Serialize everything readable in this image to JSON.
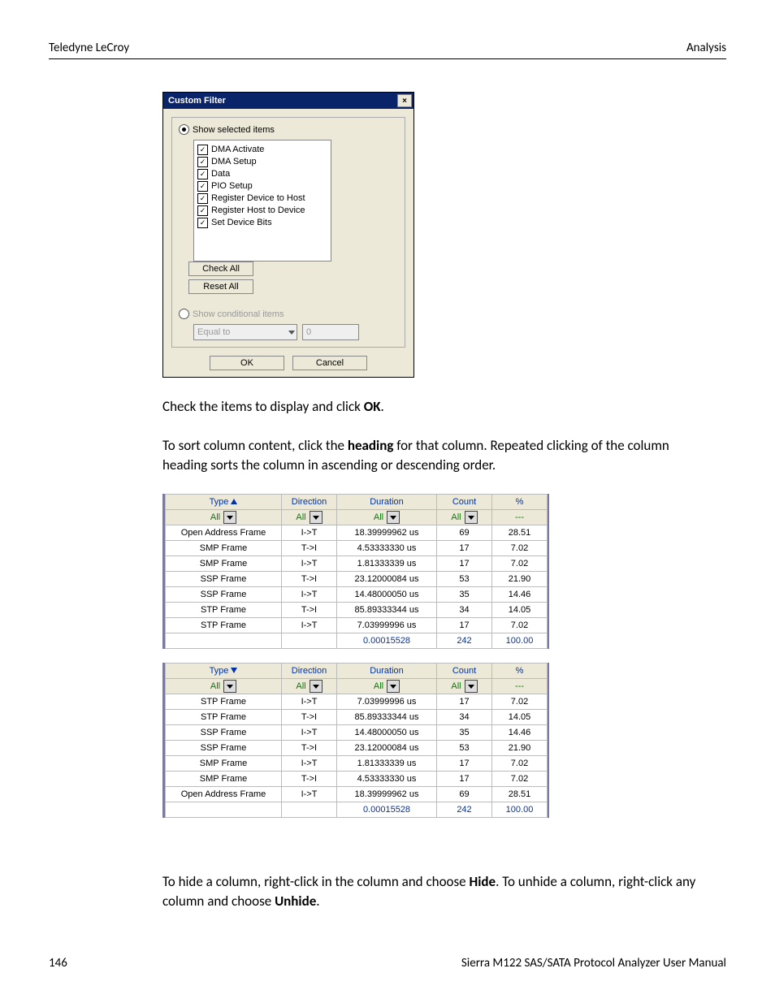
{
  "header": {
    "left": "Teledyne LeCroy",
    "right": "Analysis"
  },
  "footer": {
    "page": "146",
    "manual": "Sierra M122 SAS/SATA Protocol Analyzer User Manual"
  },
  "dialog": {
    "title": "Custom Filter",
    "radio_selected": "Show selected items",
    "radio_conditional": "Show conditional items",
    "items": [
      "DMA Activate",
      "DMA Setup",
      "Data",
      "PIO Setup",
      "Register Device to Host",
      "Register Host to Device",
      "Set Device Bits"
    ],
    "check_all": "Check All",
    "reset_all": "Reset All",
    "cond_op": "Equal to",
    "cond_val": "0",
    "ok": "OK",
    "cancel": "Cancel"
  },
  "para1_a": "Check the items to display and click ",
  "para1_b": "OK",
  "para1_c": ".",
  "para2_a": "To sort column content, click the ",
  "para2_b": "heading",
  "para2_c": " for that column. Repeated clicking of the column heading sorts the column in ascending or descending order.",
  "para3_a": "To hide a column, right-click in the column and choose ",
  "para3_b": "Hide",
  "para3_c": ". To unhide a column, right-click any column and choose ",
  "para3_d": "Unhide",
  "para3_e": ".",
  "table_headers": {
    "type": "Type",
    "direction": "Direction",
    "duration": "Duration",
    "count": "Count",
    "pct": "%"
  },
  "filter_all": "All",
  "pct_dash": "---",
  "table_asc": {
    "rows": [
      {
        "type": "Open Address Frame",
        "dir": "I->T",
        "dur": "18.39999962 us",
        "count": "69",
        "pct": "28.51"
      },
      {
        "type": "SMP Frame",
        "dir": "T->I",
        "dur": "4.53333330 us",
        "count": "17",
        "pct": "7.02"
      },
      {
        "type": "SMP Frame",
        "dir": "I->T",
        "dur": "1.81333339 us",
        "count": "17",
        "pct": "7.02"
      },
      {
        "type": "SSP Frame",
        "dir": "T->I",
        "dur": "23.12000084 us",
        "count": "53",
        "pct": "21.90"
      },
      {
        "type": "SSP Frame",
        "dir": "I->T",
        "dur": "14.48000050 us",
        "count": "35",
        "pct": "14.46"
      },
      {
        "type": "STP Frame",
        "dir": "T->I",
        "dur": "85.89333344 us",
        "count": "34",
        "pct": "14.05"
      },
      {
        "type": "STP Frame",
        "dir": "I->T",
        "dur": "7.03999996 us",
        "count": "17",
        "pct": "7.02"
      }
    ],
    "total": {
      "dur": "0.00015528",
      "count": "242",
      "pct": "100.00"
    }
  },
  "table_desc": {
    "rows": [
      {
        "type": "STP Frame",
        "dir": "I->T",
        "dur": "7.03999996 us",
        "count": "17",
        "pct": "7.02"
      },
      {
        "type": "STP Frame",
        "dir": "T->I",
        "dur": "85.89333344 us",
        "count": "34",
        "pct": "14.05"
      },
      {
        "type": "SSP Frame",
        "dir": "I->T",
        "dur": "14.48000050 us",
        "count": "35",
        "pct": "14.46"
      },
      {
        "type": "SSP Frame",
        "dir": "T->I",
        "dur": "23.12000084 us",
        "count": "53",
        "pct": "21.90"
      },
      {
        "type": "SMP Frame",
        "dir": "I->T",
        "dur": "1.81333339 us",
        "count": "17",
        "pct": "7.02"
      },
      {
        "type": "SMP Frame",
        "dir": "T->I",
        "dur": "4.53333330 us",
        "count": "17",
        "pct": "7.02"
      },
      {
        "type": "Open Address Frame",
        "dir": "I->T",
        "dur": "18.39999962 us",
        "count": "69",
        "pct": "28.51"
      }
    ],
    "total": {
      "dur": "0.00015528",
      "count": "242",
      "pct": "100.00"
    }
  }
}
